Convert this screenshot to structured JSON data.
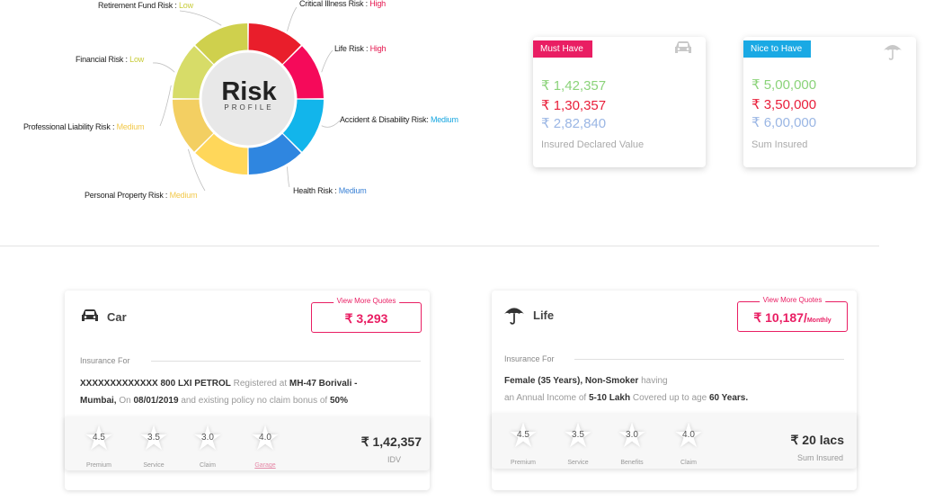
{
  "risk_profile": {
    "title": "Risk",
    "subtitle": "PROFILE",
    "items": [
      {
        "name": "Retirement Fund Risk :",
        "level": "Low"
      },
      {
        "name": "Critical Illness Risk :",
        "level": "High"
      },
      {
        "name": "Life Risk :",
        "level": "High"
      },
      {
        "name": "Financial Risk :",
        "level": "Low"
      },
      {
        "name": "Accident & Disability Risk:",
        "level": "Medium"
      },
      {
        "name": "Professional Liability Risk :",
        "level": "Medium"
      },
      {
        "name": "Health Risk :",
        "level": "Medium"
      },
      {
        "name": "Personal Property Risk :",
        "level": "Medium"
      }
    ],
    "segment_colors": [
      "#cfd04d",
      "#e91e2b",
      "#f50a5a",
      "#12b5eb",
      "#2f86e0",
      "#ffd75a",
      "#f3cf62",
      "#d7dc68"
    ]
  },
  "must_have": {
    "ribbon": "Must Have",
    "ribbon_color": "#e91e63",
    "values": [
      "₹ 1,42,357",
      "₹ 1,30,357",
      "₹ 2,82,840"
    ],
    "value_colors": [
      "#8bd37a",
      "#e91e3a",
      "#9ab6e4"
    ],
    "caption": "Insured Declared Value",
    "icon": "car-icon"
  },
  "nice_to_have": {
    "ribbon": "Nice to Have",
    "ribbon_color": "#1aa9e4",
    "values": [
      "₹ 5,00,000",
      "₹ 3,50,000",
      "₹ 6,00,000"
    ],
    "value_colors": [
      "#8bd37a",
      "#e91e3a",
      "#9ab6e4"
    ],
    "caption": "Sum Insured",
    "icon": "umbrella-icon"
  },
  "car": {
    "title": "Car",
    "quote_label": "View More Quotes",
    "quote_value": "₹ 3,293",
    "insurance_for": "Insurance For",
    "line1": {
      "model": "XXXXXXXXXXXXX 800 LXI PETROL",
      "reg_text": "Registered at",
      "reg": "MH-47 Borivali -"
    },
    "line2": {
      "city": "Mumbai,",
      "on": "On",
      "date": "08/01/2019",
      "text": "and existing policy no claim bonus of",
      "ncb": "50%"
    },
    "ratings": [
      {
        "value": "4.5",
        "label": "Premium"
      },
      {
        "value": "3.5",
        "label": "Service"
      },
      {
        "value": "3.0",
        "label": "Claim"
      },
      {
        "value": "4.0",
        "label": "Garage"
      }
    ],
    "amount": "₹ 1,42,357",
    "amount_label": "IDV"
  },
  "life": {
    "title": "Life",
    "quote_label": "View More Quotes",
    "quote_value": "₹ 10,187/",
    "quote_suffix": "Monthly",
    "insurance_for": "Insurance For",
    "line1": {
      "who": "Female (35 Years), Non-Smoker",
      "having": "having"
    },
    "line2": {
      "pre": "an Annual Income of",
      "income": "5-10 Lakh",
      "mid": "Covered up to age",
      "age": "60 Years."
    },
    "ratings": [
      {
        "value": "4.5",
        "label": "Premium"
      },
      {
        "value": "3.5",
        "label": "Service"
      },
      {
        "value": "3.0",
        "label": "Benefits"
      },
      {
        "value": "4.0",
        "label": "Claim"
      }
    ],
    "amount": "₹ 20 lacs",
    "amount_label": "Sum Insured"
  }
}
